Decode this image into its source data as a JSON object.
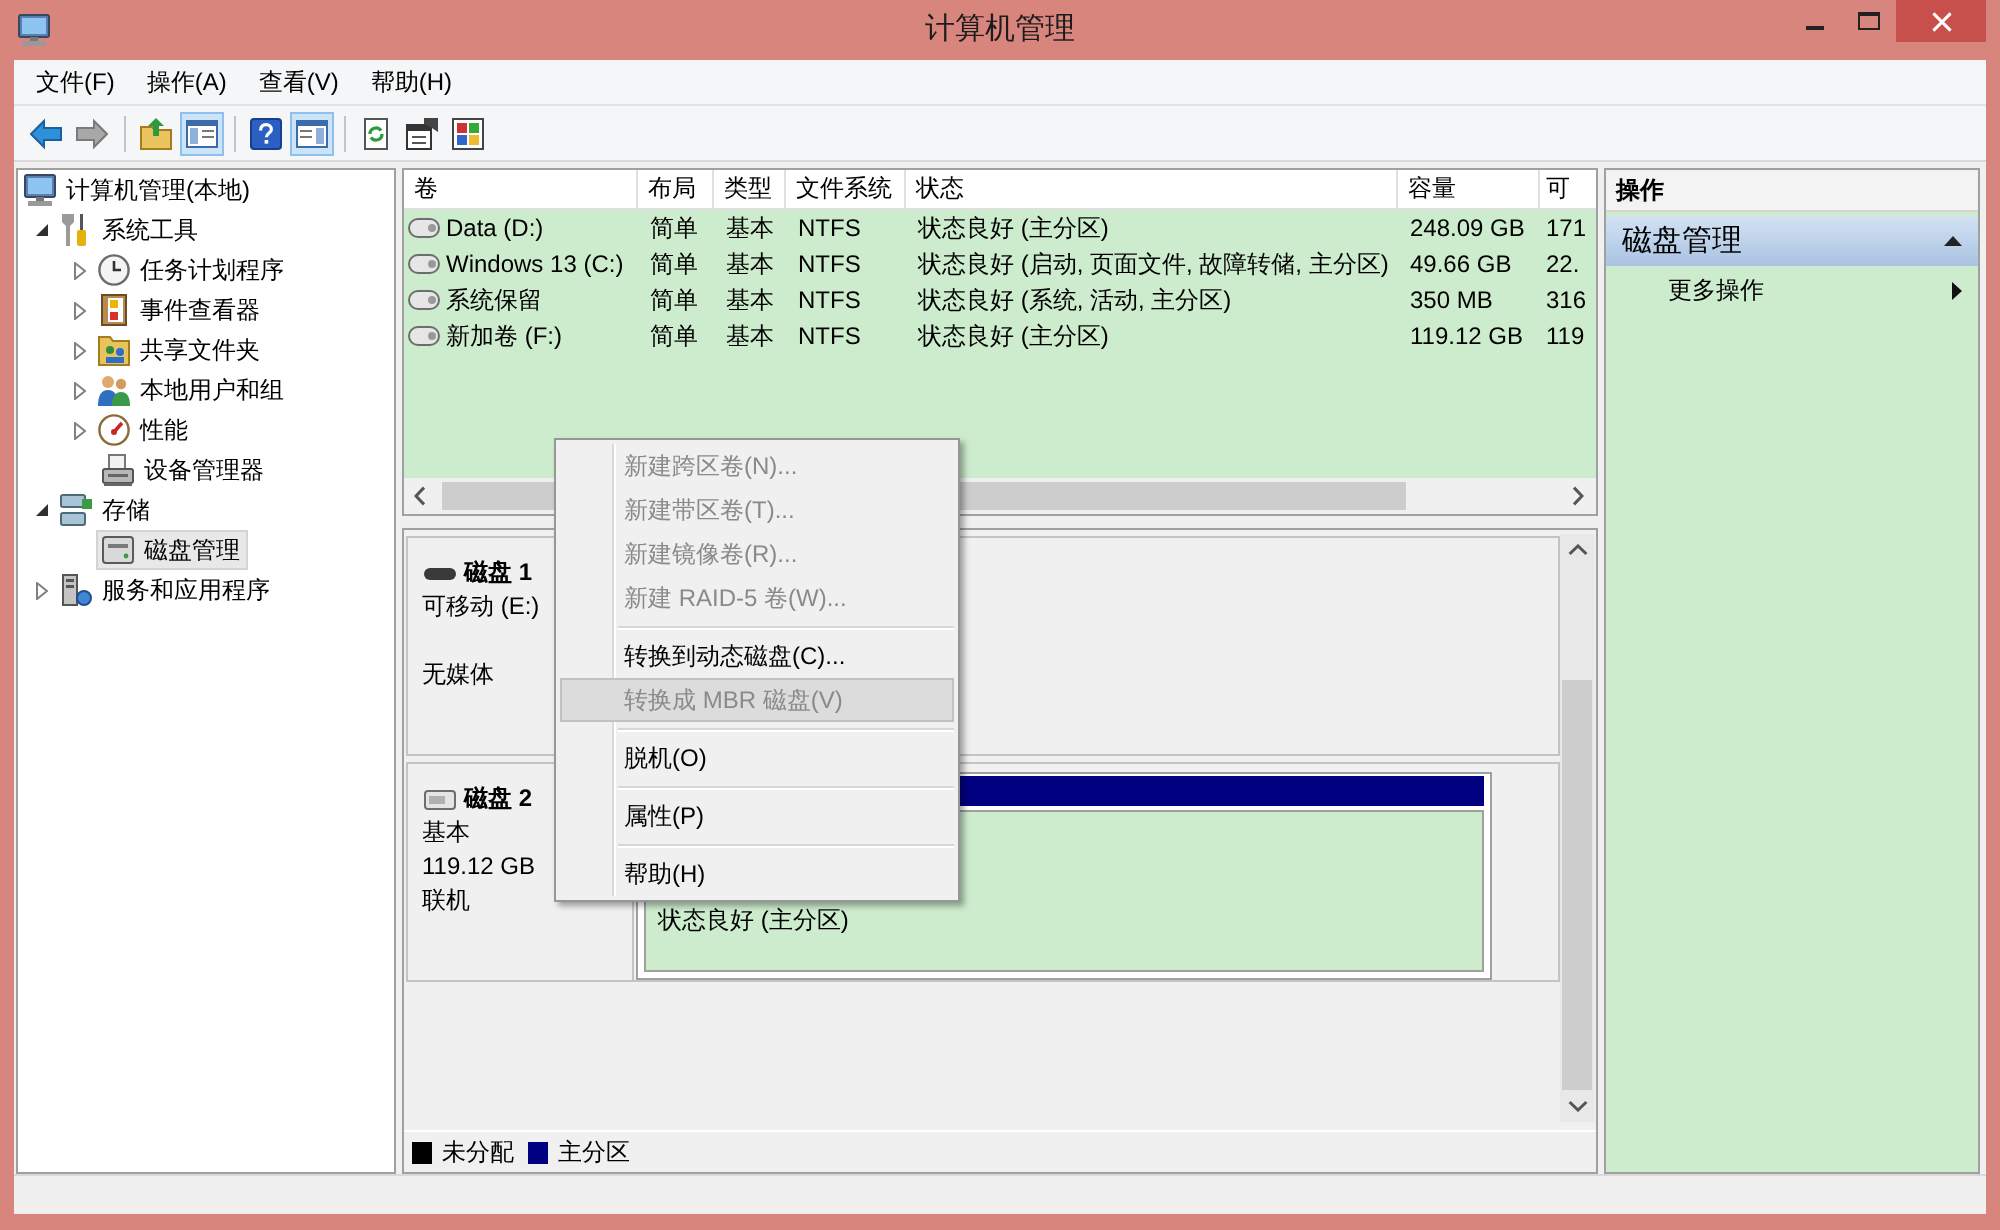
{
  "window": {
    "title": "计算机管理"
  },
  "menu_bar": [
    "文件(F)",
    "操作(A)",
    "查看(V)",
    "帮助(H)"
  ],
  "toolbar": [
    [
      {
        "kind": "back",
        "disabled": false,
        "pressed": false
      },
      {
        "kind": "forward",
        "disabled": true,
        "pressed": false
      }
    ],
    [
      {
        "kind": "up",
        "disabled": false,
        "pressed": false
      },
      {
        "kind": "tree",
        "disabled": false,
        "pressed": true
      }
    ],
    [
      {
        "kind": "help",
        "disabled": false,
        "pressed": false
      },
      {
        "kind": "actions",
        "disabled": false,
        "pressed": true
      }
    ],
    [
      {
        "kind": "refresh",
        "disabled": false,
        "pressed": false
      },
      {
        "kind": "properties",
        "disabled": false,
        "pressed": false
      },
      {
        "kind": "export",
        "disabled": false,
        "pressed": false
      }
    ]
  ],
  "tree": [
    {
      "label": "计算机管理(本地)",
      "kind": "computer",
      "selected": false,
      "children": [
        {
          "label": "系统工具",
          "kind": "tools",
          "expander": true,
          "expanded": true,
          "selected": false,
          "children": [
            {
              "label": "任务计划程序",
              "kind": "scheduler",
              "expander": true,
              "expanded": false,
              "selected": false
            },
            {
              "label": "事件查看器",
              "kind": "events",
              "expander": true,
              "expanded": false,
              "selected": false
            },
            {
              "label": "共享文件夹",
              "kind": "shares",
              "expander": true,
              "expanded": false,
              "selected": false
            },
            {
              "label": "本地用户和组",
              "kind": "users",
              "expander": true,
              "expanded": false,
              "selected": false
            },
            {
              "label": "性能",
              "kind": "performance",
              "expander": true,
              "expanded": false,
              "selected": false
            },
            {
              "label": "设备管理器",
              "kind": "devices",
              "expander": false,
              "expanded": false,
              "selected": false
            }
          ]
        },
        {
          "label": "存储",
          "kind": "storage",
          "expander": true,
          "expanded": true,
          "selected": false,
          "children": [
            {
              "label": "磁盘管理",
              "kind": "disks",
              "expander": false,
              "expanded": false,
              "selected": true
            }
          ]
        },
        {
          "label": "服务和应用程序",
          "kind": "services",
          "expander": true,
          "expanded": false,
          "selected": false
        }
      ]
    }
  ],
  "volumes": {
    "columns": [
      "卷",
      "布局",
      "类型",
      "文件系统",
      "状态",
      "容量",
      "可"
    ],
    "rows": [
      [
        "Data (D:)",
        "简单",
        "基本",
        "NTFS",
        "状态良好 (主分区)",
        "248.09 GB",
        "171"
      ],
      [
        "Windows 13 (C:)",
        "简单",
        "基本",
        "NTFS",
        "状态良好 (启动, 页面文件, 故障转储, 主分区)",
        "49.66 GB",
        "22."
      ],
      [
        "系统保留",
        "简单",
        "基本",
        "NTFS",
        "状态良好 (系统, 活动, 主分区)",
        "350 MB",
        "316"
      ],
      [
        "新加卷 (F:)",
        "简单",
        "基本",
        "NTFS",
        "状态良好 (主分区)",
        "119.12 GB",
        "119"
      ]
    ]
  },
  "disks": [
    {
      "name": "磁盘 1",
      "kind": "removable",
      "type": "可移动 (E:)",
      "status": "无媒体"
    },
    {
      "name": "磁盘 2",
      "kind": "basic",
      "type": "基本",
      "size": "119.12 GB",
      "status": "联机",
      "partitions": [
        {
          "status": "状态良好 (主分区)",
          "color": "#000080"
        }
      ]
    }
  ],
  "legend": [
    {
      "label": "未分配",
      "color": "#000000"
    },
    {
      "label": "主分区",
      "color": "#000080"
    }
  ],
  "actions": {
    "title": "操作",
    "sections": [
      {
        "label": "磁盘管理",
        "expanded": true,
        "items": [
          {
            "label": "更多操作",
            "submenu": true
          }
        ]
      }
    ]
  },
  "context_menu": {
    "groups": [
      [
        {
          "label": "新建跨区卷(N)...",
          "disabled": true,
          "selected": false
        },
        {
          "label": "新建带区卷(T)...",
          "disabled": true,
          "selected": false
        },
        {
          "label": "新建镜像卷(R)...",
          "disabled": true,
          "selected": false
        },
        {
          "label": "新建 RAID-5 卷(W)...",
          "disabled": true,
          "selected": false
        }
      ],
      [
        {
          "label": "转换到动态磁盘(C)...",
          "disabled": false,
          "selected": false
        },
        {
          "label": "转换成 MBR 磁盘(V)",
          "disabled": true,
          "selected": true
        }
      ],
      [
        {
          "label": "脱机(O)",
          "disabled": false,
          "selected": false
        }
      ],
      [
        {
          "label": "属性(P)",
          "disabled": false,
          "selected": false
        }
      ],
      [
        {
          "label": "帮助(H)",
          "disabled": false,
          "selected": false
        }
      ]
    ]
  }
}
